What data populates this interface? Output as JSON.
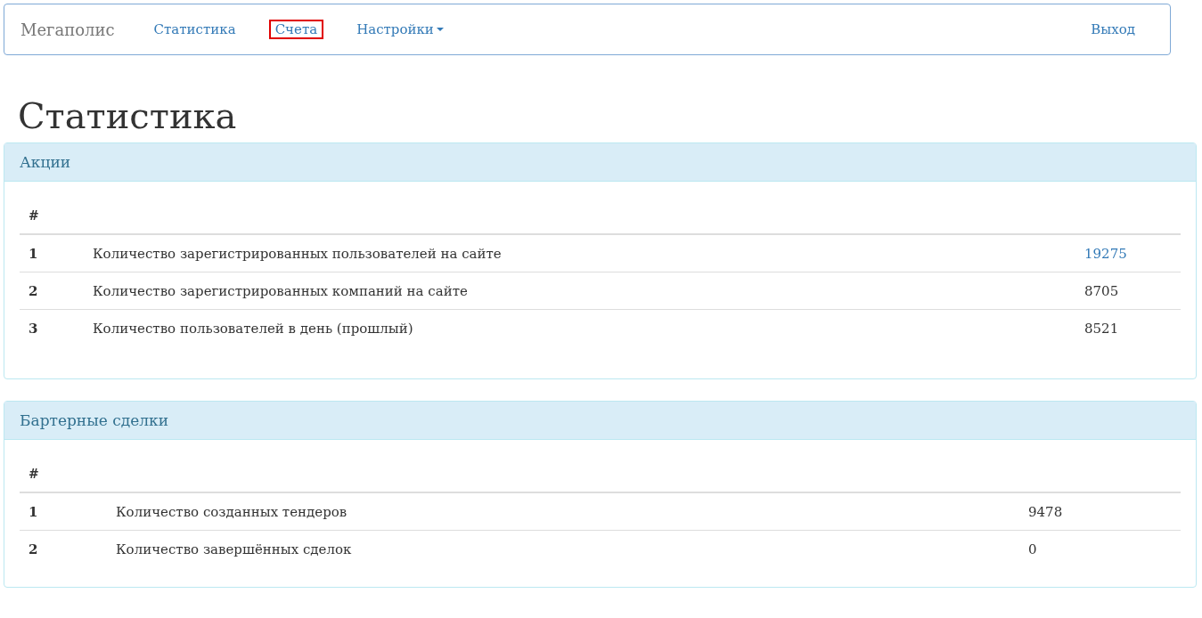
{
  "navbar": {
    "brand": "Мегаполис",
    "items": [
      {
        "label": "Статистика",
        "highlighted": false,
        "dropdown": false
      },
      {
        "label": "Счета",
        "highlighted": true,
        "dropdown": false
      },
      {
        "label": "Настройки",
        "highlighted": false,
        "dropdown": true
      }
    ],
    "logout": "Выход"
  },
  "page_title": "Статистика",
  "panels": [
    {
      "title": "Акции",
      "header": "#",
      "rows": [
        {
          "num": "1",
          "name": "Количество зарегистрированных пользователей на сайте",
          "value": "19275",
          "kind": "link"
        },
        {
          "num": "2",
          "name": "Количество зарегистрированных компаний на сайте",
          "value": "8705",
          "kind": "text"
        },
        {
          "num": "3",
          "name": "Количество пользователей в день (прошлый)",
          "value": "8521",
          "kind": "text"
        }
      ]
    },
    {
      "title": "Бартерные сделки",
      "header": "#",
      "rows": [
        {
          "num": "1",
          "name": "Количество созданных тендеров",
          "value": "9478",
          "kind": "text"
        },
        {
          "num": "2",
          "name": "Количество завершённых сделок",
          "value": "0",
          "kind": "text"
        }
      ]
    }
  ]
}
